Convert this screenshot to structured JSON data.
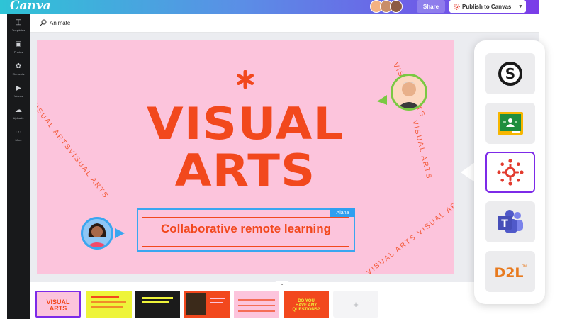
{
  "app": {
    "logo": "Canva"
  },
  "topbar": {
    "share_label": "Share",
    "publish_label": "Publish to Canvas",
    "publish_dropdown": "chevron-down-icon"
  },
  "sidebar": {
    "items": [
      {
        "label": "Templates",
        "icon": "templates-icon"
      },
      {
        "label": "Photos",
        "icon": "photos-icon"
      },
      {
        "label": "Elements",
        "icon": "elements-icon"
      },
      {
        "label": "Videos",
        "icon": "videos-icon"
      },
      {
        "label": "Uploads",
        "icon": "uploads-icon"
      },
      {
        "label": "More",
        "icon": "more-icon"
      }
    ]
  },
  "toolbar": {
    "animate_label": "Animate"
  },
  "canvas": {
    "title_line1": "VISUAL",
    "title_line2": "ARTS",
    "subtitle": "Collaborative remote learning",
    "selection_user": "Alana",
    "ring_text_right_top": "VISUAL ARTS",
    "ring_text_left": "VISUAL ARTSVISUAL ARTS",
    "ring_text_right_bottom": "VISUAL ARTS VISUAL ARTS",
    "background_color": "#fcc4dc",
    "accent_color": "#f2481d"
  },
  "filmstrip": {
    "thumbs": [
      {
        "text": "VISUAL ARTS",
        "bg": "#fcc4dc",
        "fg": "#f2481d"
      },
      {
        "text": "",
        "bg": "#eef43a",
        "fg": "#f2481d"
      },
      {
        "text": "",
        "bg": "#1b1b1b",
        "fg": "#eef43a"
      },
      {
        "text": "",
        "bg": "#f2481d",
        "fg": "#fcc4dc"
      },
      {
        "text": "",
        "bg": "#fcc4dc",
        "fg": "#f2481d"
      },
      {
        "text": "DO YOU HAVE ANY QUESTIONS?",
        "bg": "#f2481d",
        "fg": "#eef43a"
      }
    ],
    "add_label": "+"
  },
  "lms": {
    "items": [
      {
        "name": "Schoology",
        "icon": "schoology-icon",
        "label": "S"
      },
      {
        "name": "Google Classroom",
        "icon": "google-classroom-icon",
        "label": ""
      },
      {
        "name": "Canvas",
        "icon": "canvas-lms-icon",
        "label": ""
      },
      {
        "name": "Microsoft Teams",
        "icon": "teams-icon",
        "label": "T"
      },
      {
        "name": "D2L",
        "icon": "d2l-icon",
        "label": "D2L"
      }
    ],
    "selected": "Canvas"
  }
}
